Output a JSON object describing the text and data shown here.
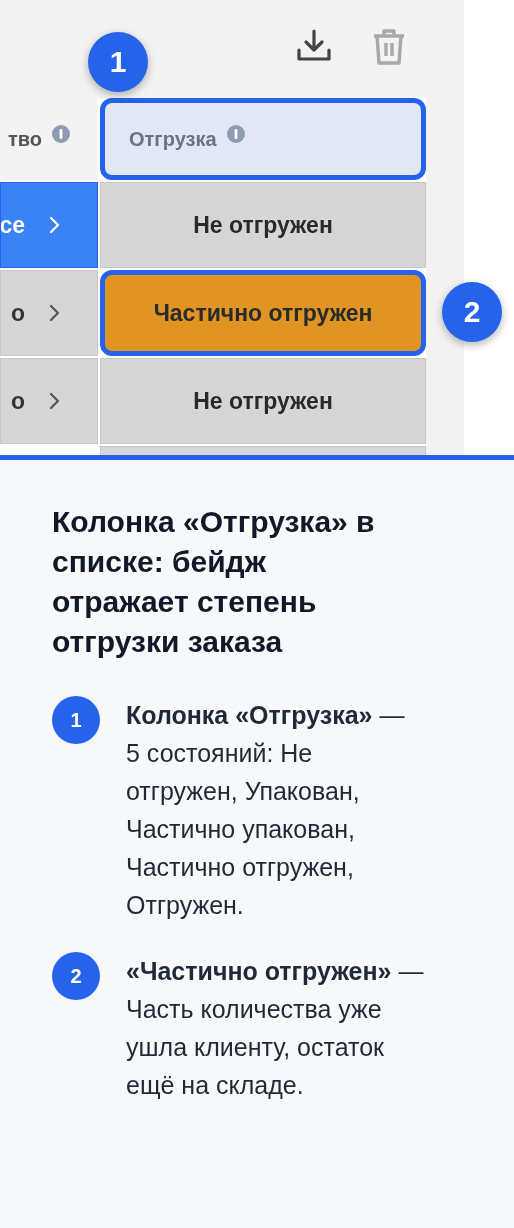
{
  "toolbar": {
    "buttons": [
      {
        "kind": "download",
        "disabled": false
      },
      {
        "kind": "delete",
        "disabled": true
      }
    ]
  },
  "table": {
    "columns": [
      {
        "label": "тво",
        "info": true,
        "highlighted": false
      },
      {
        "label": "Отгрузка",
        "info": true,
        "highlighted": true
      }
    ],
    "rows": [
      {
        "cell_1": "се",
        "selected": true,
        "shipment": "Не отгружен",
        "color": "#d6d6d6",
        "highlighted": false
      },
      {
        "cell_1": "о",
        "selected": false,
        "shipment": "Частично отгружен",
        "color": "#e09422",
        "highlighted": true
      },
      {
        "cell_1": "о",
        "selected": false,
        "shipment": "Не отгружен",
        "color": "#d6d6d6",
        "highlighted": false
      }
    ]
  },
  "callouts": [
    {
      "number": "1"
    },
    {
      "number": "2"
    }
  ],
  "panel": {
    "title": "Колонка «Отгрузка» в списке: бейдж отражает степень отгрузки заказа",
    "items": [
      {
        "number": "1",
        "text": "**Колонка «Отгрузка»** — 5 состояний: Не отгружен, Упакован, Частично упакован, Частично отгружен, Отгружен."
      },
      {
        "number": "2",
        "text": "**«Частично отгружен»** — Часть количества уже ушла клиенту, остаток ещё на складе."
      }
    ]
  }
}
